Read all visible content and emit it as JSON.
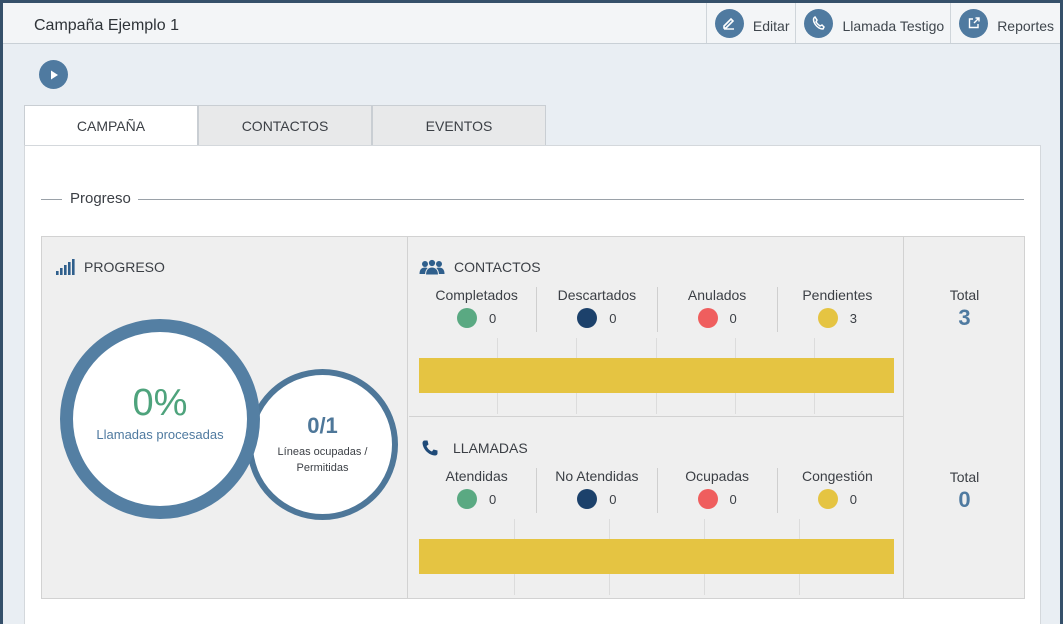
{
  "window": {
    "title": "Campaña Ejemplo 1"
  },
  "actions": [
    {
      "label": "Editar",
      "icon": "pencil-icon"
    },
    {
      "label": "Llamada Testigo",
      "icon": "phone-icon"
    },
    {
      "label": "Reportes",
      "icon": "external-link-icon"
    }
  ],
  "tabs": [
    {
      "label": "CAMPAÑA",
      "active": true
    },
    {
      "label": "CONTACTOS",
      "active": false
    },
    {
      "label": "EVENTOS",
      "active": false
    }
  ],
  "section": {
    "title": "Progreso"
  },
  "progress": {
    "header": "PROGRESO",
    "percent_text": "0%",
    "percent_label": "Llamadas procesadas",
    "lines_text": "0/1",
    "lines_label": "Líneas ocupadas / Permitidas"
  },
  "contacts": {
    "header": "CONTACTOS",
    "stats": [
      {
        "name": "Completados",
        "value": "0",
        "color": "#5aa982"
      },
      {
        "name": "Descartados",
        "value": "0",
        "color": "#1c416b"
      },
      {
        "name": "Anulados",
        "value": "0",
        "color": "#ef5e5e"
      },
      {
        "name": "Pendientes",
        "value": "3",
        "color": "#e5c442"
      }
    ],
    "total_label": "Total",
    "total_value": "3"
  },
  "calls": {
    "header": "LLAMADAS",
    "stats": [
      {
        "name": "Atendidas",
        "value": "0",
        "color": "#5aa982"
      },
      {
        "name": "No Atendidas",
        "value": "0",
        "color": "#1c416b"
      },
      {
        "name": "Ocupadas",
        "value": "0",
        "color": "#ef5e5e"
      },
      {
        "name": "Congestión",
        "value": "0",
        "color": "#e5c442"
      }
    ],
    "total_label": "Total",
    "total_value": "0"
  },
  "colors": {
    "accent": "#4f7aa0",
    "ring": "#547fa3",
    "bar": "#e5c442",
    "percent": "#4ea37c"
  }
}
